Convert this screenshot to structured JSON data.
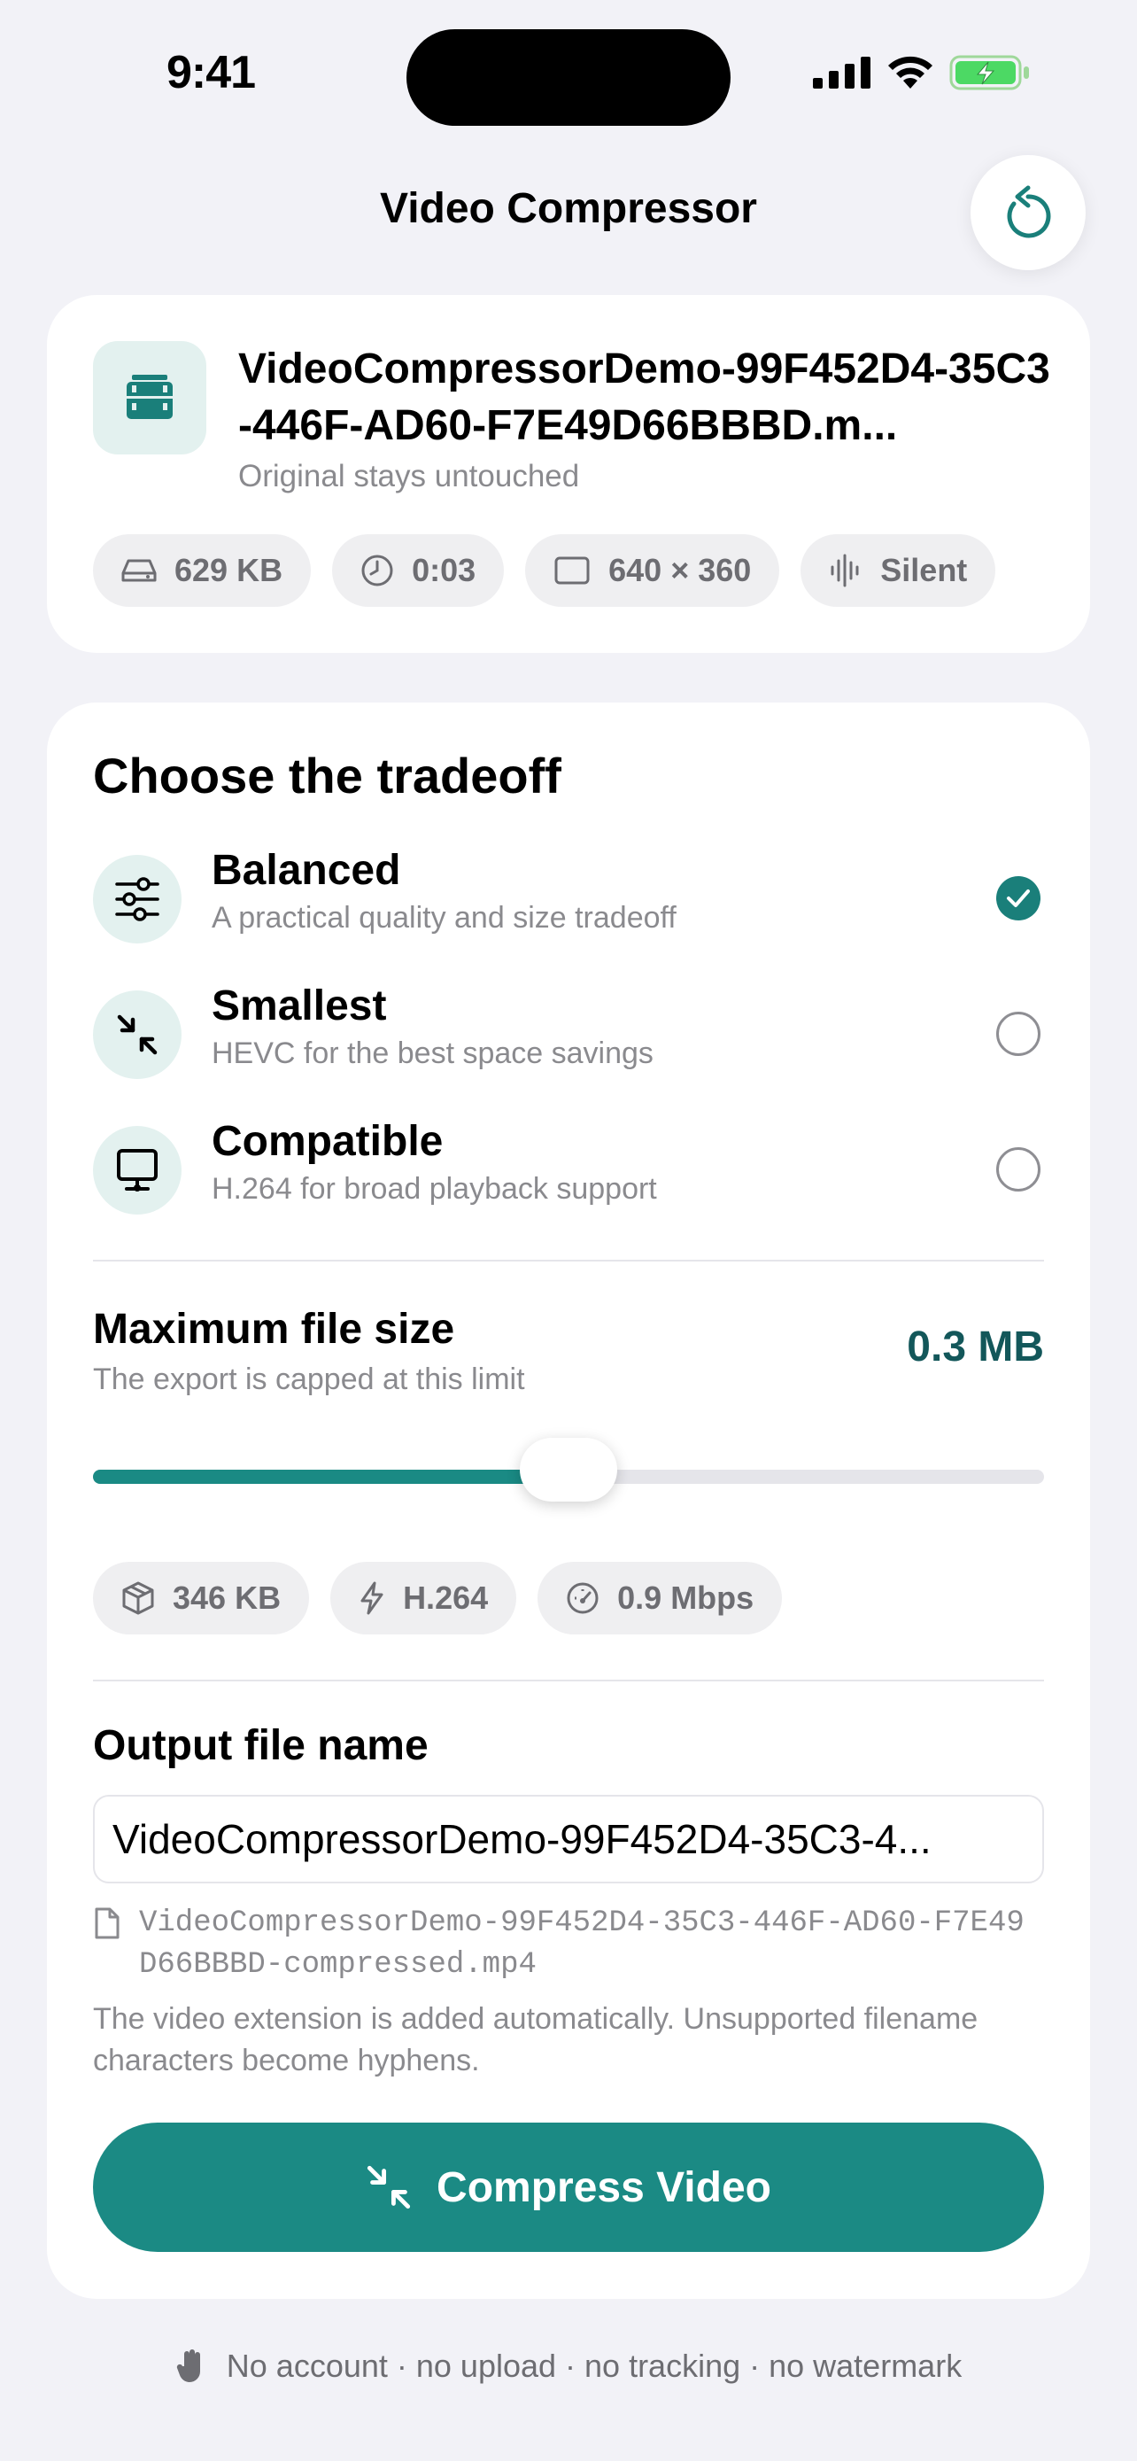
{
  "status": {
    "time": "9:41"
  },
  "header": {
    "title": "Video Compressor"
  },
  "file": {
    "name": "VideoCompressorDemo-99F452D4-35C3-446F-AD60-F7E49D66BBBD.m...",
    "subtitle": "Original stays untouched",
    "chips": {
      "size": "629 KB",
      "duration": "0:03",
      "resolution": "640 × 360",
      "audio": "Silent"
    }
  },
  "tradeoff": {
    "title": "Choose the tradeoff",
    "options": [
      {
        "title": "Balanced",
        "desc": "A practical quality and size tradeoff",
        "selected": true
      },
      {
        "title": "Smallest",
        "desc": "HEVC for the best space savings",
        "selected": false
      },
      {
        "title": "Compatible",
        "desc": "H.264 for broad playback support",
        "selected": false
      }
    ]
  },
  "max_size": {
    "title": "Maximum file size",
    "desc": "The export is capped at this limit",
    "value": "0.3 MB",
    "slider_fraction": 0.5
  },
  "estimates": {
    "size": "346 KB",
    "codec": "H.264",
    "bitrate": "0.9 Mbps"
  },
  "output": {
    "title": "Output file name",
    "input_value": "VideoCompressorDemo-99F452D4-35C3-4...",
    "preview": "VideoCompressorDemo-99F452D4-35C3-446F-AD60-F7E49D66BBBD-compressed.mp4",
    "hint": "The video extension is added automatically. Unsupported filename characters become hyphens."
  },
  "action": {
    "label": "Compress Video"
  },
  "footer": {
    "text": "No account · no upload · no tracking · no watermark"
  },
  "colors": {
    "accent": "#1b8a84",
    "accent_dark": "#13575a",
    "background": "#f2f2f7"
  }
}
